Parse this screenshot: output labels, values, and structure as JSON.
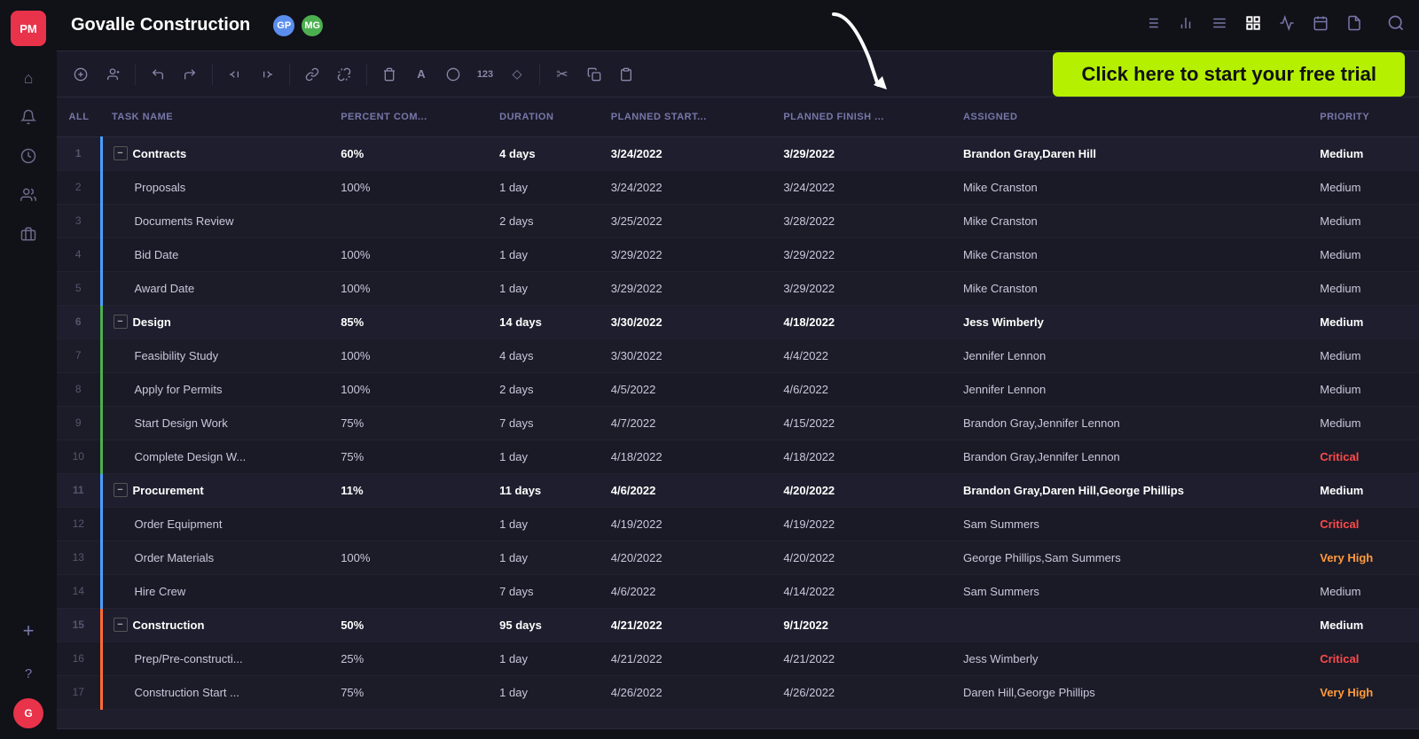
{
  "sidebar": {
    "logo": "PM",
    "items": [
      {
        "name": "home",
        "icon": "⌂",
        "active": false
      },
      {
        "name": "notifications",
        "icon": "🔔",
        "active": false
      },
      {
        "name": "time",
        "icon": "🕐",
        "active": false
      },
      {
        "name": "team",
        "icon": "👥",
        "active": false
      },
      {
        "name": "briefcase",
        "icon": "💼",
        "active": false
      },
      {
        "name": "add",
        "icon": "+",
        "active": false
      },
      {
        "name": "help",
        "icon": "?",
        "active": false
      }
    ],
    "avatar": "G"
  },
  "topbar": {
    "title": "Govalle Construction",
    "avatars": [
      "GP",
      "MG"
    ],
    "icons": [
      "list",
      "bars",
      "align",
      "grid",
      "pulse",
      "calendar",
      "file"
    ]
  },
  "toolbar": {
    "tools": [
      "+circle",
      "person+",
      "undo",
      "redo",
      "indent-left",
      "indent-right",
      "link",
      "unlink",
      "trash",
      "font",
      "shape",
      "123",
      "diamond",
      "scissors",
      "copy",
      "paste"
    ]
  },
  "free_trial": {
    "label": "Click here to start your free trial"
  },
  "table": {
    "columns": [
      "ALL",
      "TASK NAME",
      "PERCENT COM...",
      "DURATION",
      "PLANNED START...",
      "PLANNED FINISH ...",
      "ASSIGNED",
      "PRIORITY"
    ],
    "rows": [
      {
        "num": "1",
        "name": "Contracts",
        "isGroup": true,
        "colorBar": "blue",
        "pct": "60%",
        "dur": "4 days",
        "start": "3/24/2022",
        "finish": "3/29/2022",
        "assigned": "Brandon Gray,Daren Hill",
        "priority": "Medium"
      },
      {
        "num": "2",
        "name": "Proposals",
        "isGroup": false,
        "colorBar": "blue",
        "pct": "100%",
        "dur": "1 day",
        "start": "3/24/2022",
        "finish": "3/24/2022",
        "assigned": "Mike Cranston",
        "priority": "Medium"
      },
      {
        "num": "3",
        "name": "Documents Review",
        "isGroup": false,
        "colorBar": "blue",
        "pct": "",
        "dur": "2 days",
        "start": "3/25/2022",
        "finish": "3/28/2022",
        "assigned": "Mike Cranston",
        "priority": "Medium"
      },
      {
        "num": "4",
        "name": "Bid Date",
        "isGroup": false,
        "colorBar": "blue",
        "pct": "100%",
        "dur": "1 day",
        "start": "3/29/2022",
        "finish": "3/29/2022",
        "assigned": "Mike Cranston",
        "priority": "Medium"
      },
      {
        "num": "5",
        "name": "Award Date",
        "isGroup": false,
        "colorBar": "blue",
        "pct": "100%",
        "dur": "1 day",
        "start": "3/29/2022",
        "finish": "3/29/2022",
        "assigned": "Mike Cranston",
        "priority": "Medium"
      },
      {
        "num": "6",
        "name": "Design",
        "isGroup": true,
        "colorBar": "green",
        "pct": "85%",
        "dur": "14 days",
        "start": "3/30/2022",
        "finish": "4/18/2022",
        "assigned": "Jess Wimberly",
        "priority": "Medium"
      },
      {
        "num": "7",
        "name": "Feasibility Study",
        "isGroup": false,
        "colorBar": "green",
        "pct": "100%",
        "dur": "4 days",
        "start": "3/30/2022",
        "finish": "4/4/2022",
        "assigned": "Jennifer Lennon",
        "priority": "Medium"
      },
      {
        "num": "8",
        "name": "Apply for Permits",
        "isGroup": false,
        "colorBar": "green",
        "pct": "100%",
        "dur": "2 days",
        "start": "4/5/2022",
        "finish": "4/6/2022",
        "assigned": "Jennifer Lennon",
        "priority": "Medium"
      },
      {
        "num": "9",
        "name": "Start Design Work",
        "isGroup": false,
        "colorBar": "green",
        "pct": "75%",
        "dur": "7 days",
        "start": "4/7/2022",
        "finish": "4/15/2022",
        "assigned": "Brandon Gray,Jennifer Lennon",
        "priority": "Medium"
      },
      {
        "num": "10",
        "name": "Complete Design W...",
        "isGroup": false,
        "colorBar": "green",
        "pct": "75%",
        "dur": "1 day",
        "start": "4/18/2022",
        "finish": "4/18/2022",
        "assigned": "Brandon Gray,Jennifer Lennon",
        "priority": "Critical"
      },
      {
        "num": "11",
        "name": "Procurement",
        "isGroup": true,
        "colorBar": "blue2",
        "pct": "11%",
        "dur": "11 days",
        "start": "4/6/2022",
        "finish": "4/20/2022",
        "assigned": "Brandon Gray,Daren Hill,George Phillips",
        "priority": "Medium"
      },
      {
        "num": "12",
        "name": "Order Equipment",
        "isGroup": false,
        "colorBar": "blue2",
        "pct": "",
        "dur": "1 day",
        "start": "4/19/2022",
        "finish": "4/19/2022",
        "assigned": "Sam Summers",
        "priority": "Critical"
      },
      {
        "num": "13",
        "name": "Order Materials",
        "isGroup": false,
        "colorBar": "blue2",
        "pct": "100%",
        "dur": "1 day",
        "start": "4/20/2022",
        "finish": "4/20/2022",
        "assigned": "George Phillips,Sam Summers",
        "priority": "Very High"
      },
      {
        "num": "14",
        "name": "Hire Crew",
        "isGroup": false,
        "colorBar": "blue2",
        "pct": "",
        "dur": "7 days",
        "start": "4/6/2022",
        "finish": "4/14/2022",
        "assigned": "Sam Summers",
        "priority": "Medium"
      },
      {
        "num": "15",
        "name": "Construction",
        "isGroup": true,
        "colorBar": "orange",
        "pct": "50%",
        "dur": "95 days",
        "start": "4/21/2022",
        "finish": "9/1/2022",
        "assigned": "",
        "priority": "Medium"
      },
      {
        "num": "16",
        "name": "Prep/Pre-constructi...",
        "isGroup": false,
        "colorBar": "orange",
        "pct": "25%",
        "dur": "1 day",
        "start": "4/21/2022",
        "finish": "4/21/2022",
        "assigned": "Jess Wimberly",
        "priority": "Critical"
      },
      {
        "num": "17",
        "name": "Construction Start ...",
        "isGroup": false,
        "colorBar": "orange",
        "pct": "75%",
        "dur": "1 day",
        "start": "4/26/2022",
        "finish": "4/26/2022",
        "assigned": "Daren Hill,George Phillips",
        "priority": "Very High"
      }
    ]
  }
}
